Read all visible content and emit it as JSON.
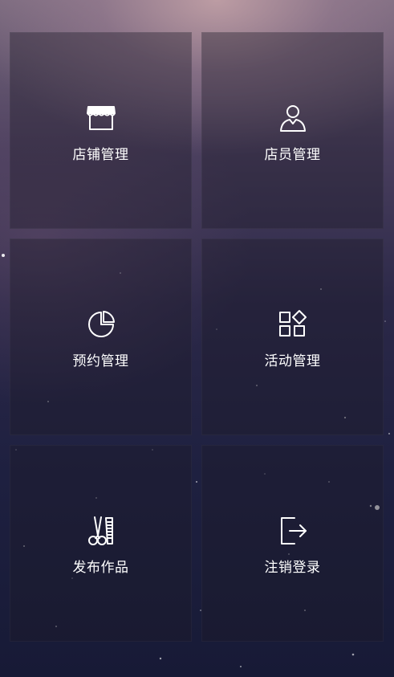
{
  "menu": {
    "items": [
      {
        "label": "店铺管理",
        "icon": "store-icon"
      },
      {
        "label": "店员管理",
        "icon": "staff-icon"
      },
      {
        "label": "预约管理",
        "icon": "pie-chart-icon"
      },
      {
        "label": "活动管理",
        "icon": "apps-grid-icon"
      },
      {
        "label": "发布作品",
        "icon": "scissors-comb-icon"
      },
      {
        "label": "注销登录",
        "icon": "logout-icon"
      }
    ]
  },
  "colors": {
    "text": "#ffffff",
    "tile_background": "rgba(30,26,40,0.38)"
  }
}
